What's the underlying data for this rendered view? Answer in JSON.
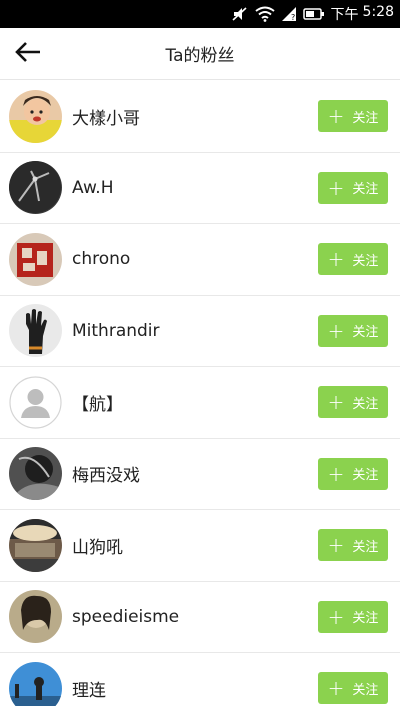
{
  "status_bar": {
    "period": "下午",
    "time": "5:28",
    "icons": [
      "mute-icon",
      "wifi-icon",
      "signal-icon",
      "battery-icon"
    ]
  },
  "header": {
    "title": "Ta的粉丝",
    "back_icon": "arrow-left-icon"
  },
  "colors": {
    "accent": "#8bd24e",
    "status_bar": "#000000",
    "divider": "#e8e8e8"
  },
  "follow_button": {
    "plus": "+",
    "label": "关注"
  },
  "followers": [
    {
      "name": "大樣小哥"
    },
    {
      "name": "Aw.H"
    },
    {
      "name": "chrono"
    },
    {
      "name": "Mithrandir"
    },
    {
      "name": "【航】"
    },
    {
      "name": "梅西没戏"
    },
    {
      "name": "山狗吼"
    },
    {
      "name": "speedieisme"
    },
    {
      "name": "理连"
    }
  ]
}
